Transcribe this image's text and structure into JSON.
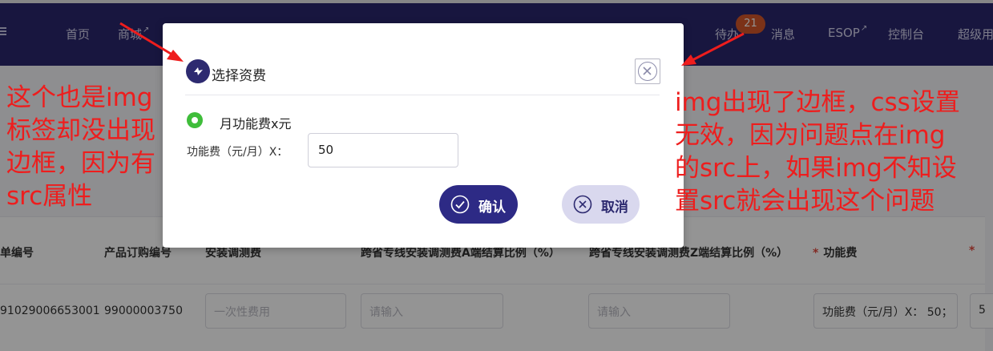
{
  "nav": {
    "items": [
      {
        "label": "首页",
        "external": false
      },
      {
        "label": "商城",
        "external": true
      },
      {
        "label": "待办",
        "external": false
      },
      {
        "label": "消息",
        "external": false
      },
      {
        "label": "ESOP",
        "external": true
      },
      {
        "label": "控制台",
        "external": false
      },
      {
        "label": "超级用",
        "external": false
      }
    ],
    "badge_count": "21"
  },
  "table": {
    "headers": [
      "单编号",
      "产品订购编号",
      "安装调测费",
      "跨省专线安装调测费A端结算比例（%）",
      "跨省专线安装调测费Z端结算比例（%）",
      "功能费",
      "*"
    ],
    "required_mark": "*",
    "row": {
      "order_no": "91029006653001",
      "product_no": "99000003750",
      "install_placeholder": "一次性费用",
      "a_ratio_placeholder": "请输入",
      "z_ratio_placeholder": "请输入",
      "fee_value": "功能费（元/月）X： 50；",
      "last_value": "5"
    }
  },
  "modal": {
    "title": "选择资费",
    "option_label": "月功能费x元",
    "fee_label": "功能费（元/月）X：",
    "fee_value": "50",
    "confirm_label": "确认",
    "cancel_label": "取消"
  },
  "annotations": {
    "left": [
      "这个也是img",
      "标签却没出现",
      "边框，因为有",
      "src属性"
    ],
    "right": [
      "img出现了边框，css设置",
      "无效，因为问题点在img",
      "的src上，如果img不知设",
      "置src就会出现这个问题"
    ]
  },
  "colors": {
    "nav_bg": "#2a276d",
    "primary": "#2d2a85",
    "radio": "#3fbd3a",
    "annotation": "#ee1d1d",
    "badge": "#d4572a"
  }
}
